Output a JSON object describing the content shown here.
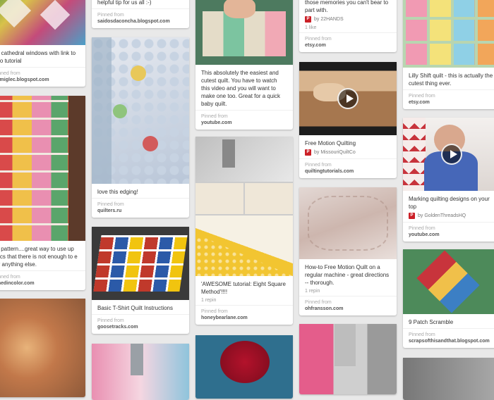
{
  "pins": {
    "c1p1": {
      "desc": "ax cathedral windows with link to deo tutorial",
      "pinned_from": "Pinned from",
      "source": "nomiglec.blogspot.com"
    },
    "c1p2": {
      "desc": "ck pattern....great way to use up brics that there is not enough to e for anything else.",
      "pinned_from": "Pinned from",
      "source": "ichedincolor.com"
    },
    "c2p1": {
      "desc": "helpful tip for us all :-)",
      "pinned_from": "Pinned from",
      "source": "saidosdaconcha.blogspot.com"
    },
    "c2p2": {
      "desc": "love this edging!",
      "pinned_from": "Pinned from",
      "source": "quilters.ru"
    },
    "c2p3": {
      "desc": "Basic T-Shirt Quilt Instructions",
      "pinned_from": "Pinned from",
      "source": "goosetracks.com"
    },
    "c3p1": {
      "desc": "This absolutely the easiest and cutest quilt. You have to watch this video and you will want to make one too. Great for a quick baby quilt.",
      "pinned_from": "Pinned from",
      "source": "youtube.com"
    },
    "c3p2": {
      "desc": "'AWESOME tutorial: Eight Square Method'!!!!",
      "stats": "1 repin",
      "pinned_from": "Pinned from",
      "source": "honeybearlane.com"
    },
    "c4p1": {
      "desc": "those memories you can't bear to part with.",
      "user": "by 22HANDS",
      "stats": "1 like",
      "pinned_from": "Pinned from",
      "source": "etsy.com"
    },
    "c4p2": {
      "desc": "Free Motion Quilting",
      "user": "by MissouriQuiltCo",
      "pinned_from": "Pinned from",
      "source": "quiltingtutorials.com"
    },
    "c4p3": {
      "desc": "How-to Free Motion Quilt on a regular machine - great directions -- thorough.",
      "stats": "1 repin",
      "pinned_from": "Pinned from",
      "source": "ohfransson.com"
    },
    "c5p1": {
      "desc": "Lilly Shift quilt - this is actually the cutest thing ever.",
      "pinned_from": "Pinned from",
      "source": "etsy.com"
    },
    "c5p2": {
      "desc": "Marking quilting designs on your top",
      "user": "by GoldenThreadsHQ",
      "pinned_from": "Pinned from",
      "source": "youtube.com"
    },
    "c5p3": {
      "desc": "9 Patch Scramble",
      "pinned_from": "Pinned from",
      "source": "scrapsofthisandthat.blogspot.com"
    }
  },
  "icons": {
    "play": "play-button-icon",
    "user_badge": "pinterest-user-icon"
  },
  "colors": {
    "background": "#e9e9e9",
    "card": "#ffffff",
    "brand_red": "#cb2027"
  }
}
